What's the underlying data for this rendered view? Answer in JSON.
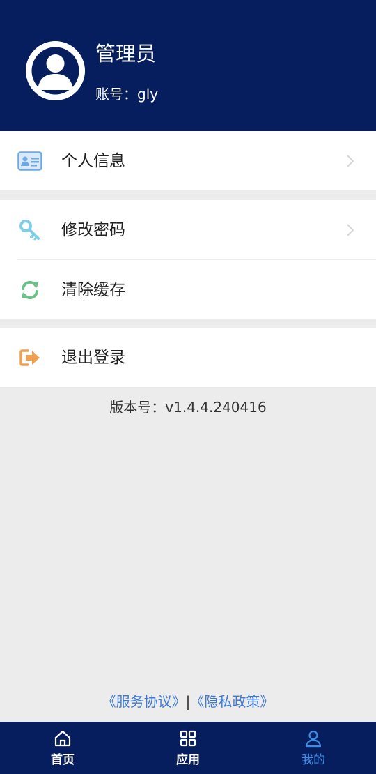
{
  "profile": {
    "name": "管理员",
    "account": "账号：gly"
  },
  "menu": {
    "personal_info": "个人信息",
    "change_password": "修改密码",
    "clear_cache": "清除缓存",
    "logout": "退出登录"
  },
  "version": "版本号：v1.4.4.240416",
  "legal": {
    "service": "《服务协议》",
    "separator": "|",
    "privacy": "《隐私政策》"
  },
  "tabs": {
    "home": "首页",
    "apps": "应用",
    "mine": "我的"
  },
  "colors": {
    "header_bg": "#061e5e",
    "tab_active": "#3a8ee6",
    "link": "#3d7ad8",
    "page_bg": "#ececec"
  },
  "icons": {
    "avatar": "user-avatar-icon",
    "personal_info": "id-card-icon",
    "change_password": "key-icon",
    "clear_cache": "refresh-icon",
    "logout": "sign-out-icon",
    "home": "home-icon",
    "apps": "grid-icon",
    "mine": "user-icon"
  }
}
